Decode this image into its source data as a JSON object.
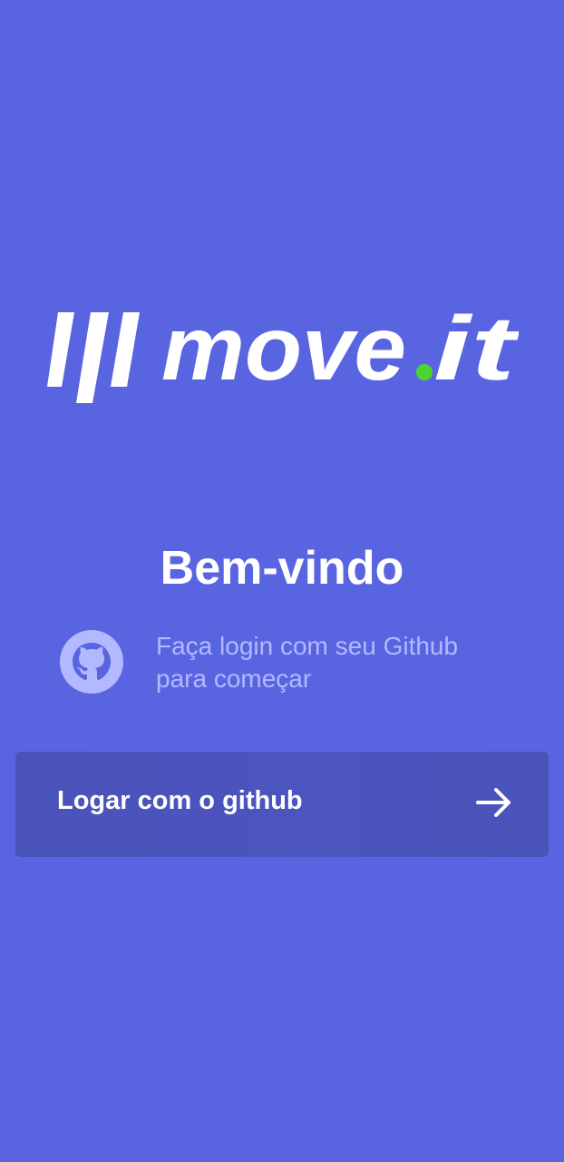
{
  "logo": {
    "text_main": "move",
    "text_dot": ".",
    "text_suffix": "it",
    "icon": "logo-bars-icon",
    "dot_color": "#4CD62B"
  },
  "welcome": {
    "title": "Bem-vindo"
  },
  "hint": {
    "icon": "github-icon",
    "line1": "Faça login com seu Github",
    "line2": "para começar"
  },
  "login_button": {
    "label": "Logar com o github",
    "icon": "arrow-right-icon"
  },
  "colors": {
    "background": "#5965E0",
    "button": "#4953B8",
    "hint_text": "#B2B9FF",
    "github_icon": "#B2B9FF",
    "logo": "#FFFFFF",
    "accent_green": "#4CD62B"
  }
}
